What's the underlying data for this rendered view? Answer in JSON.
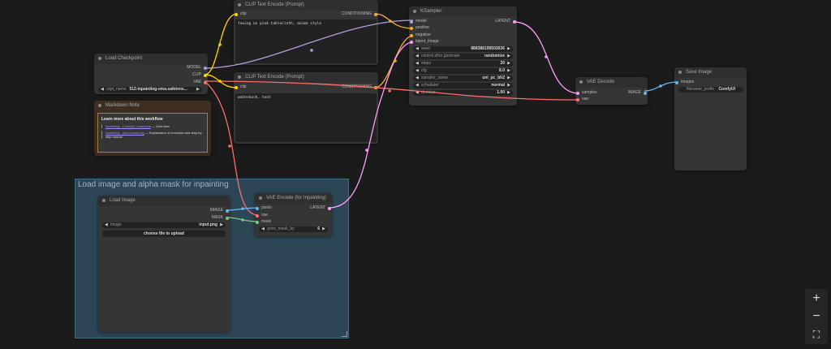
{
  "group": {
    "title": "Load image and alpha mask for inpainting"
  },
  "nodes": {
    "load_checkpoint": {
      "title": "Load Checkpoint",
      "outputs": [
        "MODEL",
        "CLIP",
        "VAE"
      ],
      "widget_label": "ckpt_name",
      "widget_value": "512-inpainting-ema.safetens..."
    },
    "markdown_note": {
      "title": "Markdown Note",
      "heading": "Learn more about this workflow",
      "items": [
        {
          "link": "Inpainting - ComfyUI_examples",
          "text": " — Overview"
        },
        {
          "link": "Inpainting - docs.comfy.org",
          "text": " — Explanation of concepts and step-by-step tutorial"
        }
      ]
    },
    "clip_pos": {
      "title": "CLIP Text Encode (Prompt)",
      "input": "clip",
      "output": "CONDITIONING",
      "text": "towing on pink tablecloth, anime style"
    },
    "clip_neg": {
      "title": "CLIP Text Encode (Prompt)",
      "input": "clip",
      "output": "CONDITIONING",
      "text": "watermark, text"
    },
    "ksampler": {
      "title": "KSampler",
      "inputs": [
        "model",
        "positive",
        "negative",
        "latent_image"
      ],
      "output": "LATENT",
      "widgets": [
        {
          "label": "seed",
          "value": "888388199502636"
        },
        {
          "label": "control after generate",
          "value": "randomize"
        },
        {
          "label": "steps",
          "value": "20"
        },
        {
          "label": "cfg",
          "value": "8.0"
        },
        {
          "label": "sampler_name",
          "value": "uni_pc_bh2"
        },
        {
          "label": "scheduler",
          "value": "normal"
        },
        {
          "label": "denoise",
          "value": "1.00"
        }
      ]
    },
    "vae_decode": {
      "title": "VAE Decode",
      "inputs": [
        "samples",
        "vae"
      ],
      "output": "IMAGE"
    },
    "save_image": {
      "title": "Save Image",
      "input": "images",
      "widget_label": "filename_prefix",
      "widget_value": "ComfyUI"
    },
    "load_image": {
      "title": "Load Image",
      "outputs": [
        "IMAGE",
        "MASK"
      ],
      "widget_label": "image",
      "widget_value": "input.png",
      "button": "choose file to upload"
    },
    "vae_encode_inpaint": {
      "title": "VAE Encode (for Inpainting)",
      "inputs": [
        "pixels",
        "vae",
        "mask"
      ],
      "output": "LATENT",
      "widget_label": "grow_mask_by",
      "widget_value": "6"
    }
  },
  "controls": {
    "zoom_in": "+",
    "zoom_out": "−",
    "fit": "⛶"
  },
  "colors": {
    "model": "#b39ddb",
    "clip": "#ffd500",
    "vae": "#ff6e6e",
    "conditioning": "#ffa931",
    "latent": "#ff9cf9",
    "image": "#64b5f6",
    "mask": "#81c784"
  }
}
